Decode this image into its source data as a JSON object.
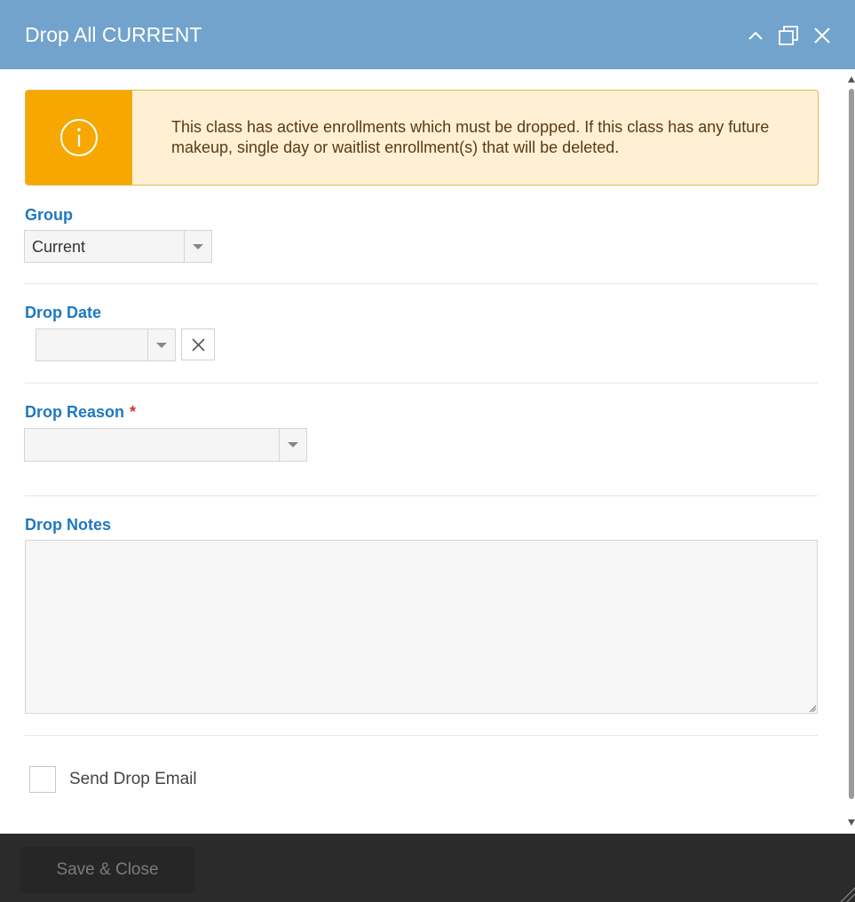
{
  "window": {
    "title": "Drop All CURRENT",
    "controls": [
      "collapse-icon",
      "maximize-icon",
      "close-icon"
    ]
  },
  "alert": {
    "icon": "info-icon",
    "message": "This class has active enrollments which must be dropped. If this class has any future makeup, single day or waitlist enrollment(s) that will be deleted."
  },
  "form": {
    "group": {
      "label": "Group",
      "value": "Current"
    },
    "drop_date": {
      "label": "Drop Date",
      "value": ""
    },
    "drop_reason": {
      "label": "Drop Reason",
      "required_marker": "*",
      "value": ""
    },
    "drop_notes": {
      "label": "Drop Notes",
      "value": ""
    },
    "send_drop_email": {
      "label": "Send Drop Email",
      "checked": false
    }
  },
  "footer": {
    "save_label": "Save & Close"
  },
  "colors": {
    "titlebar": "#72a3cc",
    "label": "#1f78c1",
    "alert_icon_bg": "#f7a800",
    "alert_bg": "#fff0d3",
    "required": "#d9322b",
    "footer": "#2b2b2b"
  }
}
